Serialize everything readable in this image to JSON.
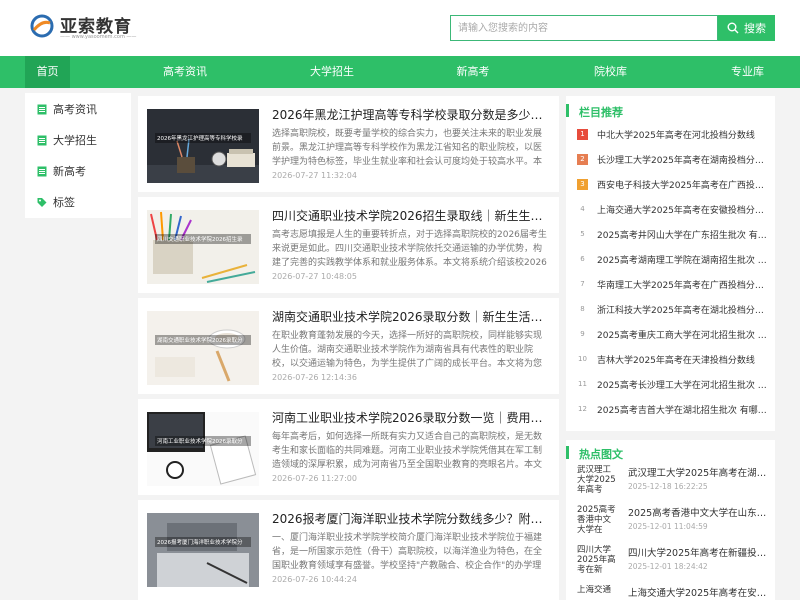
{
  "header": {
    "logo_text": "亚索教育",
    "logo_sub": "—— www.yasoomem.com ——",
    "search_placeholder": "请输入您搜索的内容",
    "search_label": "搜索"
  },
  "nav": {
    "items": [
      "首页",
      "高考资讯",
      "大学招生",
      "新高考",
      "院校库",
      "专业库"
    ]
  },
  "sidebar": {
    "items": [
      {
        "label": "高考资讯",
        "icon": "document-icon"
      },
      {
        "label": "大学招生",
        "icon": "document-icon"
      },
      {
        "label": "新高考",
        "icon": "document-icon"
      },
      {
        "label": "标签",
        "icon": "tag-icon"
      }
    ]
  },
  "articles": [
    {
      "title": "2026年黑龙江护理高等专科学校录取分数是多少？一文...",
      "desc": "选择高职院校，既要考量学校的综合实力，也要关注未来的职业发展前景。黑龙江护理高等专科学校作为黑龙江省知名的职业院校，以医学护理为特色标签，毕业生就业率和社会认可度均处于较高水平。本文将...",
      "time": "2026-07-27 11:32:04",
      "thumb_caption": "2026年黑龙江护理高等专科学校录"
    },
    {
      "title": "四川交通职业技术学院2026招生录取线｜新生生活与...",
      "desc": "高考志愿填报是人生的重要转折点，对于选择高职院校的2026届考生来说更是如此。四川交通职业技术学院依托交通运输的办学优势，构建了完善的实践教学体系和就业服务体系。本文将系统介绍该校2026年各...",
      "time": "2026-07-27 10:48:05",
      "thumb_caption": "四川交通职业技术学院2026招生录"
    },
    {
      "title": "湖南交通职业技术学院2026录取分数｜新生生活指南...",
      "desc": "在职业教育蓬勃发展的今天，选择一所好的高职院校，同样能够实现人生价值。湖南交通职业技术学院作为湖南省具有代表性的职业院校，以交通运输为特色，为学生提供了广阔的成长平台。本文将为您详细解...",
      "time": "2026-07-26 12:14:36",
      "thumb_caption": "湖南交通职业技术学院2026录取分"
    },
    {
      "title": "河南工业职业技术学院2026录取分数一览｜费用、住...",
      "desc": "每年高考后，如何选择一所既有实力又适合自己的高职院校，是无数考生和家长面临的共同难题。河南工业职业技术学院凭借其在军工制造领域的深厚积累，成为河南省乃至全国职业教育的亮眼名片。本文将围...",
      "time": "2026-07-26 11:27:00",
      "thumb_caption": "河南工业职业技术学院2026录取分"
    },
    {
      "title": "2026报考厦门海洋职业技术学院分数线多少？附报到...",
      "desc": "一、厦门海洋职业技术学院学校简介厦门海洋职业技术学院位于福建省，是一所国家示范性（骨干）高职院校，以海洋渔业为特色，在全国职业教育领域享有盛誉。学校坚持\"产教融合、校企合作\"的办学理念，...",
      "time": "2026-07-26 10:44:24",
      "thumb_caption": "2026报考厦门海洋职业技术学院分"
    }
  ],
  "recommend": {
    "title": "栏目推荐",
    "items": [
      {
        "num": "1",
        "text": "中北大学2025年高考在河北投档分数线"
      },
      {
        "num": "2",
        "text": "长沙理工大学2025年高考在湖南投档分数线"
      },
      {
        "num": "3",
        "text": "西安电子科技大学2025年高考在广西投档分数线"
      },
      {
        "num": "4",
        "text": "上海交通大学2025年高考在安徽投档分数线"
      },
      {
        "num": "5",
        "text": "2025高考井冈山大学在广东招生批次 有哪些专业"
      },
      {
        "num": "6",
        "text": "2025高考湖南理工学院在湖南招生批次 有哪些专业"
      },
      {
        "num": "7",
        "text": "华南理工大学2025年高考在广西投档分数线"
      },
      {
        "num": "8",
        "text": "浙江科技大学2025年高考在湖北投档分数线"
      },
      {
        "num": "9",
        "text": "2025高考重庆工商大学在河北招生批次 有哪些专业"
      },
      {
        "num": "10",
        "text": "吉林大学2025年高考在天津投档分数线"
      },
      {
        "num": "11",
        "text": "2025高考长沙理工大学在河北招生批次 有哪些专业"
      },
      {
        "num": "12",
        "text": "2025高考吉首大学在湖北招生批次 有哪些专业"
      }
    ]
  },
  "hot": {
    "title": "热点图文",
    "items": [
      {
        "thumb_alt": "武汉理工大学2025年高考",
        "title": "武汉理工大学2025年高考在湖北投档分数线",
        "time": "2025-12-18 16:22:25"
      },
      {
        "thumb_alt": "2025高考香港中文大学在",
        "title": "2025高考香港中文大学在山东招生批次",
        "time": "2025-12-01 11:04:59"
      },
      {
        "thumb_alt": "四川大学2025年高考在新",
        "title": "四川大学2025年高考在新疆投档分数线",
        "time": "2025-12-01 18:24:42"
      },
      {
        "thumb_alt": "上海交通",
        "title": "上海交通大学2025年高考在安徽投档分数线",
        "time": ""
      }
    ]
  },
  "colors": {
    "accent": "#2ebf68",
    "accent_dark": "#21a556",
    "rank1": "#e74c3c",
    "rank2": "#e67e52",
    "rank3": "#f0a030"
  }
}
